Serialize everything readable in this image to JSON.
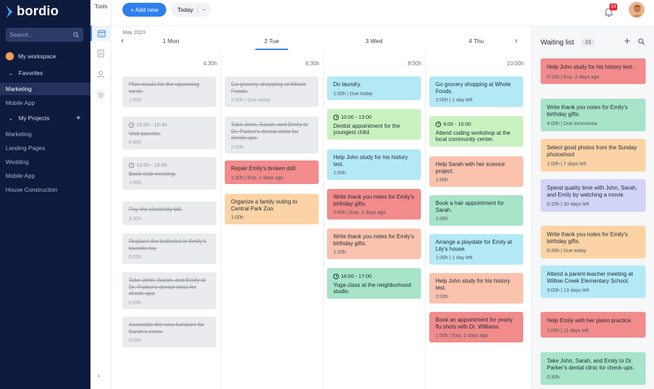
{
  "brand": {
    "name": "bordio"
  },
  "sidebar": {
    "search_placeholder": "Search...",
    "workspace": "My workspace",
    "favorites_label": "Favorites",
    "favorites": [
      "Marketing",
      "Mobile App"
    ],
    "projects_label": "My Projects",
    "projects": [
      "Marketing",
      "Landing Pages",
      "Wedding",
      "Mobile App",
      "House Construction"
    ]
  },
  "tools": {
    "label": "Tools",
    "calendar_day": "31"
  },
  "toolbar": {
    "add_label": "+ Add new",
    "today_label": "Today",
    "notification_count": "23"
  },
  "calendar": {
    "month": "May 2023",
    "days": [
      {
        "label": "1 Mon",
        "hours": "4:30h"
      },
      {
        "label": "2 Tue",
        "hours": "6:30h"
      },
      {
        "label": "3 Wed",
        "hours": "8:00h"
      },
      {
        "label": "4 Thu",
        "hours": "10:00h"
      }
    ],
    "columns": [
      [
        {
          "title": "Plan meals for the upcoming week.",
          "meta": "1:00h",
          "style": "done"
        },
        {
          "time": "10:00 - 10:40",
          "title": "Visit parents.",
          "meta": "0:40h",
          "style": "done"
        },
        {
          "time": "13:00 - 15:00",
          "title": "Book club meeting.",
          "meta": "1:00h",
          "style": "done"
        },
        {
          "title": "Pay the electricity bill.",
          "meta": "2:30h",
          "style": "done"
        },
        {
          "title": "Replace the batteries in Emily's favorite toy.",
          "meta": "0:20h",
          "style": "done"
        },
        {
          "title": "Take John, Sarah, and Emily to Dr. Parker's dental clinic for check-ups.",
          "meta": "0:20h",
          "style": "done"
        },
        {
          "title": "Assemble the new furniture for Sarah's room.",
          "meta": "0:20h",
          "style": "done"
        }
      ],
      [
        {
          "title": "Go grocery shopping at Whole Foods.",
          "meta": "2:00h | Due today",
          "style": "done"
        },
        {
          "title": "Take John, Sarah, and Emily to Dr. Parker's dental clinic for check-ups.",
          "meta": "2:00h",
          "style": "done"
        },
        {
          "title": "Repair Emily's broken doll.",
          "meta": "1:30h | Exp. 2 days ago",
          "style": "red"
        },
        {
          "title": "Organize a family outing to Central Park Zoo.",
          "meta": "1:00h",
          "style": "orange"
        }
      ],
      [
        {
          "title": "Do laundry.",
          "meta": "1:00h | Due today",
          "style": "cyan"
        },
        {
          "time": "10:00 - 13:00",
          "title": "Dentist appointment for the youngest child.",
          "meta": "",
          "style": "green"
        },
        {
          "title": "Help John study for his history test.",
          "meta": "1:00h",
          "style": "cyan"
        },
        {
          "title": "Write thank you notes for Emily's birthday gifts.",
          "meta": "0:40h | Exp. 2 days ago",
          "style": "red"
        },
        {
          "title": "Write thank you notes for Emily's birthday gifts.",
          "meta": "1:20h",
          "style": "salmon"
        },
        {
          "time": "16:00 - 17:00",
          "title": "Yoga class at the neighborhood studio.",
          "meta": "",
          "style": "teal"
        }
      ],
      [
        {
          "title": "Go grocery shopping at Whole Foods.",
          "meta": "2:00h | 1 day left",
          "style": "cyan"
        },
        {
          "time": "9:00 - 10:00",
          "title": "Attend coding workshop at the local community center.",
          "meta": "",
          "style": "green"
        },
        {
          "title": "Help Sarah with her science project.",
          "meta": "1:00h",
          "style": "salmon"
        },
        {
          "title": "Book a hair appointment for Sarah.",
          "meta": "1:00h",
          "style": "teal"
        },
        {
          "title": "Arrange a playdate for Emily at Lily's house.",
          "meta": "1:00h | 1 day left",
          "style": "cyan"
        },
        {
          "title": "Help John study for his history test.",
          "meta": "2:00h",
          "style": "salmon"
        },
        {
          "title": "Book an appointment for yearly flu shots with Dr. Williams.",
          "meta": "1:00h | Exp. 2 days ago",
          "style": "red"
        }
      ]
    ]
  },
  "waiting_list": {
    "title": "Waiting list",
    "count": "23",
    "items": [
      {
        "title": "Help John study for his history test.",
        "meta": "0:15h | Exp. 2 days ago",
        "style": "red"
      },
      {
        "title": "Write thank you notes for Emily's birthday gifts.",
        "meta": "4:00h | Due tommorow",
        "style": "teal"
      },
      {
        "title": "Select good photos from the Sunday photoshoot",
        "meta": "1:00h | 7 days left",
        "style": "orange"
      },
      {
        "title": "Spend quality time with John, Sarah, and Emily by watching a movie.",
        "meta": "0:15h | 30 days left",
        "style": "purple"
      },
      {
        "title": "Write thank you notes for Emily's birthday gifts.",
        "meta": "0:30h | Due today",
        "style": "orange"
      },
      {
        "title": "Attend a parent-teacher meeting at Willow Creek Elementary School.",
        "meta": "3:00h | 13 days left",
        "style": "cyan"
      },
      {
        "title": "Help Emily with her piano practice.",
        "meta": "1:00h | 11 days left",
        "style": "red"
      },
      {
        "title": "Take John, Sarah, and Emily to Dr. Parker's dental clinic for check-ups.",
        "meta": "0:30h",
        "style": "teal"
      }
    ]
  },
  "colors": {
    "accent": "#2f80ed",
    "sidebar_bg": "#0e1a3e",
    "done": "#e9ebee",
    "red": "#f28b8b",
    "orange": "#fcd3a5",
    "cyan": "#b4e9f6",
    "green": "#c9f2c0",
    "teal": "#a7e4c8",
    "salmon": "#fbc2ad",
    "purple": "#d2d4f7"
  }
}
